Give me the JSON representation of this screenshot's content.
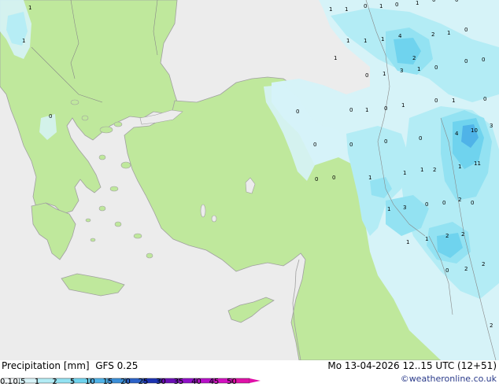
{
  "footer": {
    "title": "Precipitation [mm]",
    "model": "GFS 0.25",
    "datetime": "Mo 13-04-2026 12..15 UTC (12+51)",
    "credit": "©weatheronline.co.uk"
  },
  "legend": {
    "labels": [
      "0.1",
      "0.5",
      "1",
      "2",
      "5",
      "10",
      "15",
      "20",
      "25",
      "30",
      "35",
      "40",
      "45",
      "50"
    ],
    "colors": [
      "#f5fbfd",
      "#d6f3f8",
      "#b3ecf5",
      "#93e2f2",
      "#6fd3ee",
      "#4fb3e8",
      "#3b8fd8",
      "#2b62c8",
      "#1c33b2",
      "#6a0fb5",
      "#9010c8",
      "#b610c8",
      "#d310c0",
      "#e010a8"
    ]
  },
  "map_colors": {
    "land": "#bfe89c",
    "sea": "#ececec",
    "coast": "#a0a0a0",
    "border": "#888888"
  },
  "grid_values": [
    {
      "v": "1"
    },
    {
      "v": "1"
    },
    {
      "v": "1"
    },
    {
      "v": "0"
    },
    {
      "v": "1"
    },
    {
      "v": "0"
    },
    {
      "v": "1"
    },
    {
      "v": "0"
    },
    {
      "v": "0"
    },
    {
      "v": "1"
    },
    {
      "v": "1"
    },
    {
      "v": "1"
    },
    {
      "v": "1"
    },
    {
      "v": "4"
    },
    {
      "v": "2"
    },
    {
      "v": "1"
    },
    {
      "v": "0"
    },
    {
      "v": "1"
    },
    {
      "v": "0"
    },
    {
      "v": "0"
    },
    {
      "v": "2"
    },
    {
      "v": "0"
    },
    {
      "v": "1"
    },
    {
      "v": "3"
    },
    {
      "v": "1"
    },
    {
      "v": "0"
    },
    {
      "v": "0"
    },
    {
      "v": "0"
    },
    {
      "v": "1"
    },
    {
      "v": "1"
    },
    {
      "v": "0"
    },
    {
      "v": "0"
    },
    {
      "v": "1"
    },
    {
      "v": "0"
    },
    {
      "v": "0"
    },
    {
      "v": "4"
    },
    {
      "v": "10"
    },
    {
      "v": "3"
    },
    {
      "v": "0"
    },
    {
      "v": "0"
    },
    {
      "v": "0"
    },
    {
      "v": "0"
    },
    {
      "v": "1"
    },
    {
      "v": "11"
    },
    {
      "v": "0"
    },
    {
      "v": "0"
    },
    {
      "v": "1"
    },
    {
      "v": "1"
    },
    {
      "v": "1"
    },
    {
      "v": "2"
    },
    {
      "v": "1"
    },
    {
      "v": "3"
    },
    {
      "v": "0"
    },
    {
      "v": "0"
    },
    {
      "v": "2"
    },
    {
      "v": "1"
    },
    {
      "v": "1"
    },
    {
      "v": "2"
    },
    {
      "v": "2"
    },
    {
      "v": "2"
    },
    {
      "v": "0"
    },
    {
      "v": "2"
    },
    {
      "v": "2"
    },
    {
      "v": "0"
    }
  ]
}
